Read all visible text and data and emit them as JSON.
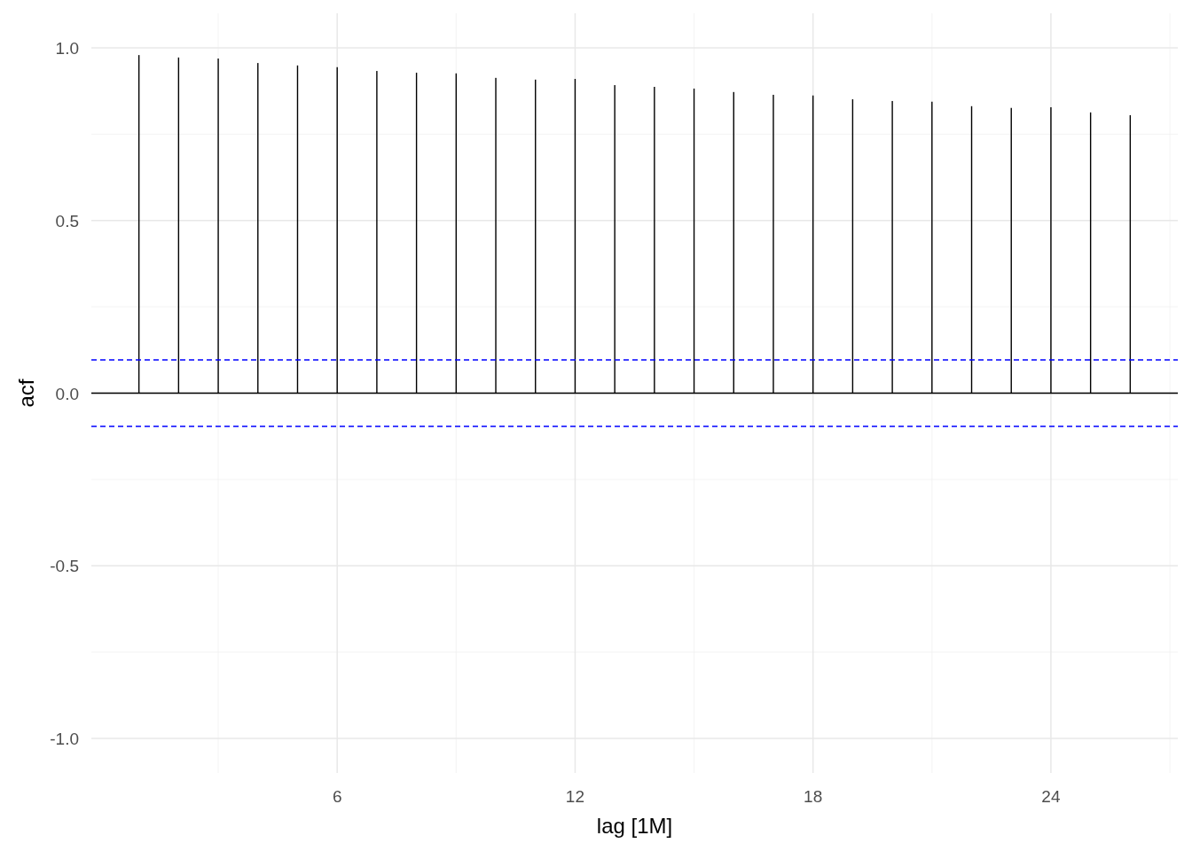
{
  "chart_data": {
    "type": "bar",
    "xlabel": "lag [1M]",
    "ylabel": "acf",
    "x": [
      1,
      2,
      3,
      4,
      5,
      6,
      7,
      8,
      9,
      10,
      11,
      12,
      13,
      14,
      15,
      16,
      17,
      18,
      19,
      20,
      21,
      22,
      23,
      24,
      25,
      26
    ],
    "values": [
      0.979,
      0.972,
      0.969,
      0.956,
      0.949,
      0.944,
      0.933,
      0.928,
      0.926,
      0.913,
      0.908,
      0.91,
      0.892,
      0.887,
      0.882,
      0.872,
      0.864,
      0.862,
      0.851,
      0.846,
      0.844,
      0.831,
      0.826,
      0.828,
      0.813,
      0.805
    ],
    "xlim": [
      -0.2,
      27.2
    ],
    "ylim": [
      -1.1,
      1.1
    ],
    "xticks": [
      6,
      12,
      18,
      24
    ],
    "yticks": [
      {
        "value": -1,
        "label": "-1.0"
      },
      {
        "value": -0.5,
        "label": "-0.5"
      },
      {
        "value": 0,
        "label": "0.0"
      },
      {
        "value": 0.5,
        "label": "0.5"
      },
      {
        "value": 1,
        "label": "1.0"
      }
    ],
    "grid": true,
    "ref_lines": [
      {
        "axis": "y",
        "value": 0.096,
        "color": "#0000ff"
      },
      {
        "axis": "y",
        "value": -0.096,
        "color": "#0000ff"
      }
    ]
  }
}
